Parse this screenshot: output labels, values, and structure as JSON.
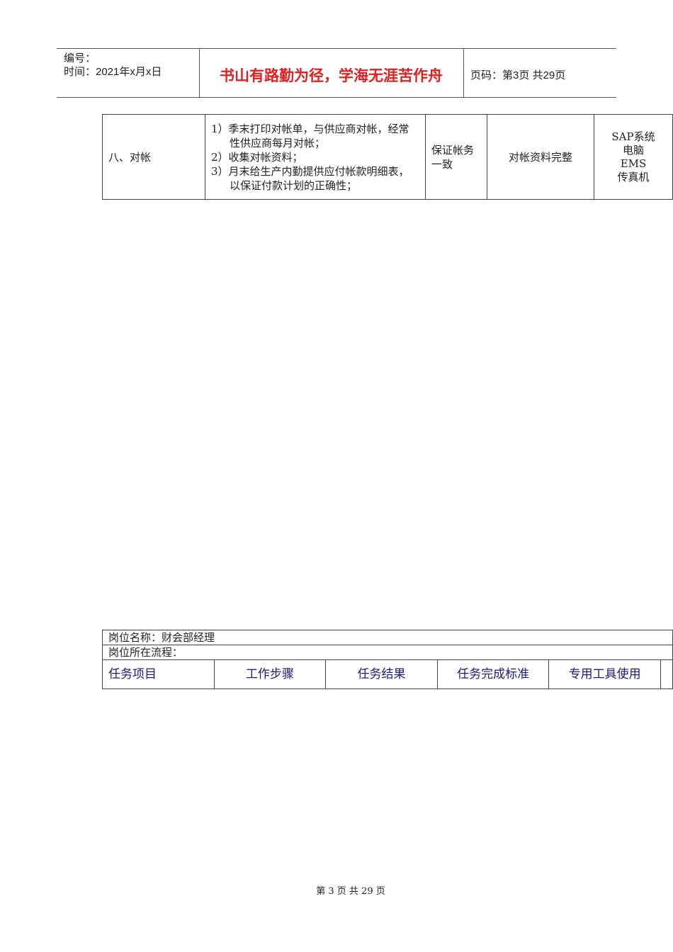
{
  "header": {
    "number_label": "编号：",
    "time_label": "时间：2021年x月x日",
    "motto": "书山有路勤为径，学海无涯苦作舟",
    "page_info": "页码：第3页 共29页"
  },
  "task_table": {
    "rows": [
      {
        "item": "八、对帐",
        "steps": [
          "1）季末打印对帐单，与供应商对帐，经常性供应商每月对帐；",
          "2）收集对帐资料；",
          "3）月末给生产内勤提供应付帐款明细表，以保证付款计划的正确性；"
        ],
        "result": "保证帐务一致",
        "standard": "对帐资料完整",
        "tools": [
          "SAP系统",
          "电脑",
          "EMS",
          "传真机"
        ]
      }
    ]
  },
  "position_table": {
    "name_label": "岗位名称：财会部经理",
    "process_label": "岗位所在流程：",
    "headers": [
      "任务项目",
      "工作步骤",
      "任务结果",
      "任务完成标准",
      "专用工具使用"
    ]
  },
  "footer": {
    "page": "第 3 页 共 29 页"
  }
}
